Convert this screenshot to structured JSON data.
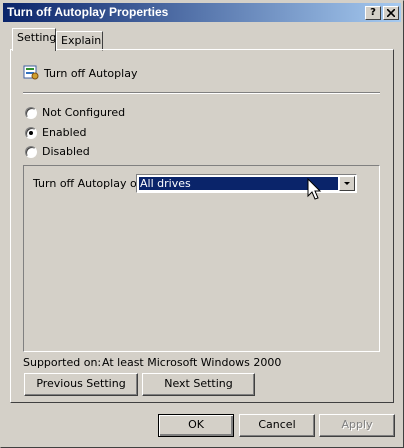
{
  "window": {
    "title": "Turn off Autoplay Properties",
    "help_button": "?",
    "close_button": "X"
  },
  "tabs": [
    {
      "label": "Setting",
      "active": true
    },
    {
      "label": "Explain",
      "active": false
    }
  ],
  "policy": {
    "name": "Turn off Autoplay",
    "icon": "policy-setting-icon"
  },
  "radios": [
    {
      "label": "Not Configured",
      "checked": false
    },
    {
      "label": "Enabled",
      "checked": true
    },
    {
      "label": "Disabled",
      "checked": false
    }
  ],
  "options": {
    "label": "Turn off Autoplay on:",
    "selected": "All drives"
  },
  "supported": {
    "label": "Supported on:",
    "value": "At least Microsoft Windows 2000"
  },
  "nav_buttons": {
    "previous": "Previous Setting",
    "next": "Next Setting"
  },
  "dialog_buttons": {
    "ok": "OK",
    "cancel": "Cancel",
    "apply": "Apply"
  },
  "colors": {
    "titlebar_start": "#0a246a",
    "titlebar_end": "#a6caf0",
    "selection": "#0a246a",
    "face": "#d4d0c8"
  }
}
